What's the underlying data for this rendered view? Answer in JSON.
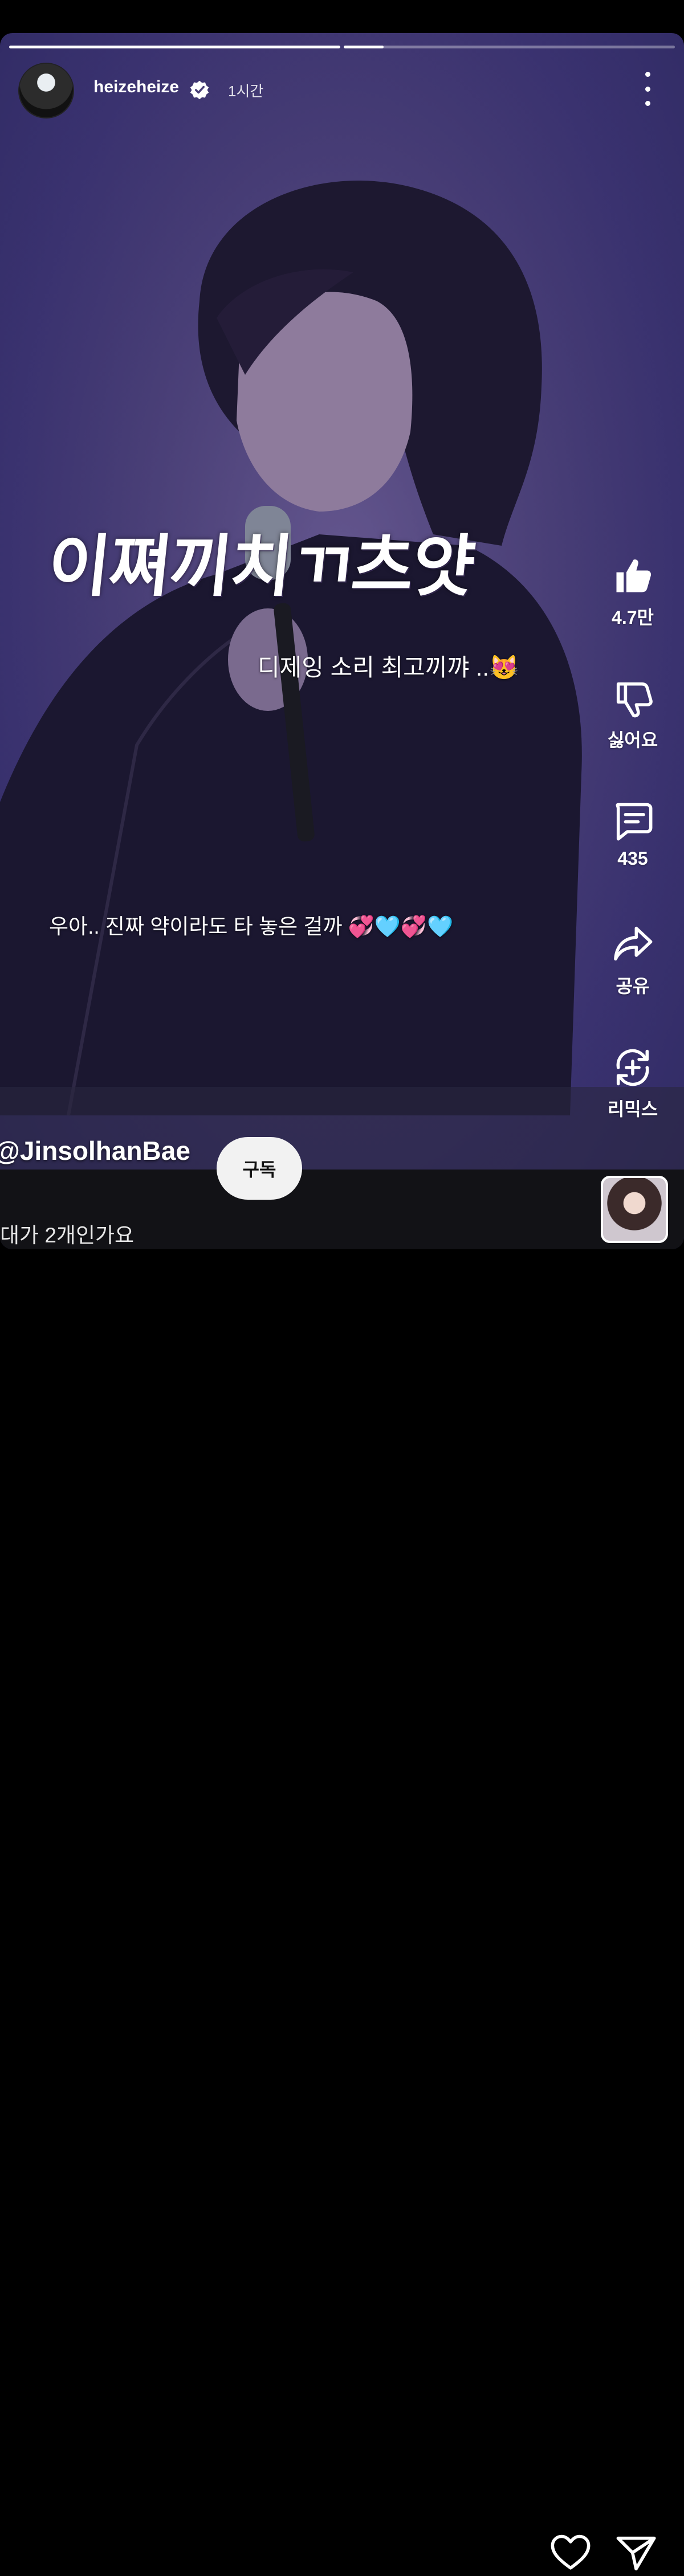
{
  "story": {
    "progress": [
      1.0,
      0.12
    ],
    "user": {
      "username": "heizeheize",
      "time": "1시간"
    }
  },
  "video": {
    "big_caption": "이쪄끼치ㄲ츠얏",
    "caption_2": "디제잉 소리 최고끼꺄 ..😻",
    "caption_3": "우아.. 진짜 약이라도 타 놓은 걸까 💞🩵💞🩵",
    "channel": "@JinsolhanBae",
    "subscribe_label": "구독",
    "title": "대가 2개인가요"
  },
  "actions": {
    "like_count": "4.7만",
    "dislike_label": "싫어요",
    "comment_count": "435",
    "share_label": "공유",
    "remix_label": "리믹스"
  },
  "icons": [
    "like-icon",
    "dislike-icon",
    "comment-icon",
    "share-icon",
    "remix-icon",
    "heart-icon",
    "send-icon",
    "more-icon",
    "verified-icon"
  ]
}
